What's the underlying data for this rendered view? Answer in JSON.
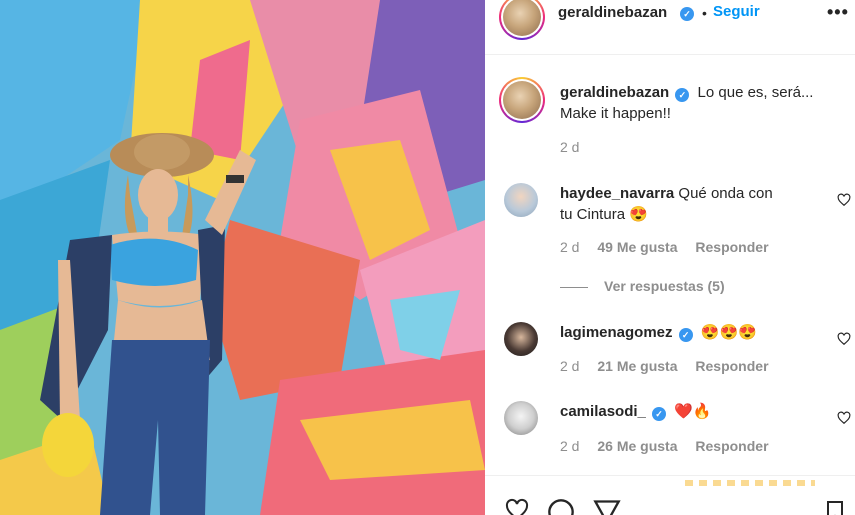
{
  "post": {
    "image": {
      "description_icon": "photo"
    },
    "header": {
      "username": "geraldinebazan",
      "dot": "•",
      "follow_label": "Seguir",
      "more_label": "•••"
    },
    "caption": {
      "username": "geraldinebazan",
      "text_line1": "Lo que es, será...",
      "text_line2": "Make it happen!!",
      "time": "2 d"
    },
    "comments": [
      {
        "username": "haydee_navarra",
        "verified": false,
        "text_line1": "Qué onda con",
        "text_line2": "tu Cintura 😍",
        "time": "2 d",
        "likes": "49 Me gusta",
        "reply": "Responder",
        "view_replies": "Ver respuestas (5)"
      },
      {
        "username": "lagimenagomez",
        "verified": true,
        "text_line1": "😍😍😍",
        "time": "2 d",
        "likes": "21 Me gusta",
        "reply": "Responder"
      },
      {
        "username": "camilasodi_",
        "verified": true,
        "text_line1": "❤️🔥",
        "time": "2 d",
        "likes": "26 Me gusta",
        "reply": "Responder"
      }
    ]
  },
  "colors": {
    "link": "#0095f6",
    "verified": "#3897f0",
    "muted": "#8e8e8e"
  }
}
